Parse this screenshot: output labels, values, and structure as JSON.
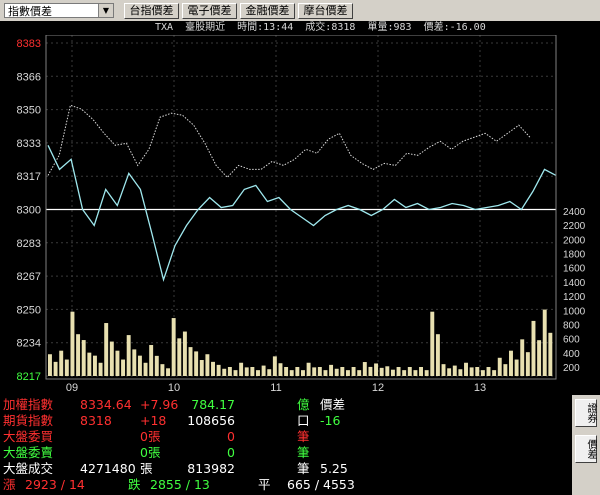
{
  "toolbar": {
    "index_select": "指數價差",
    "buttons": [
      "台指價差",
      "電子價差",
      "金融價差",
      "摩台價差"
    ]
  },
  "info_line": "TXA  臺股期近  時間:13:44  成交:8318  單量:983  價差:-16.00",
  "colors": {
    "index_line": "#dcdcdc",
    "futures_line": "#9fe8ee",
    "volume_bar": "#e8e0b0",
    "up": "#ff3030",
    "down": "#40ff40",
    "axis_red_label": "#ff3030",
    "axis_green_label": "#40ff40"
  },
  "chart_data": {
    "type": "line",
    "price_ticks": [
      "8383",
      "8366",
      "8350",
      "8333",
      "8317",
      "8300",
      "8283",
      "8267",
      "8250",
      "8234",
      "8217"
    ],
    "volume_ticks": [
      "2400",
      "2200",
      "2000",
      "1800",
      "1600",
      "1400",
      "1200",
      "1000",
      "800",
      "600",
      "400",
      "200"
    ],
    "time_ticks": [
      "09",
      "10",
      "11",
      "12",
      "13"
    ],
    "ylim": [
      8217,
      8383
    ],
    "reference": 8300,
    "series": [
      {
        "values": [
          8317,
          8327,
          8352,
          8350,
          8345,
          8338,
          8332,
          8333,
          8322,
          8330,
          8346,
          8348,
          8347,
          8342,
          8333,
          8322,
          8316,
          8322,
          8320,
          8320,
          8324,
          8322,
          8325,
          8330,
          8328,
          8335,
          8338,
          8327,
          8323,
          8320,
          8323,
          8322,
          8328,
          8327,
          8331,
          8334,
          8330,
          8334,
          8336,
          8338,
          8334,
          8338,
          8342,
          8336
        ]
      },
      {
        "values": [
          8332,
          8320,
          8325,
          8300,
          8292,
          8310,
          8302,
          8318,
          8310,
          8288,
          8265,
          8282,
          8292,
          8300,
          8306,
          8301,
          8302,
          8310,
          8312,
          8304,
          8306,
          8300,
          8296,
          8292,
          8297,
          8300,
          8302,
          8300,
          8297,
          8300,
          8305,
          8301,
          8303,
          8300,
          8301,
          8303,
          8302,
          8300,
          8301,
          8302,
          8304,
          8300,
          8309,
          8320,
          8317
        ]
      }
    ],
    "volume": [
      380,
      430,
      980,
      580,
      360,
      820,
      430,
      650,
      360,
      510,
      240,
      890,
      700,
      420,
      380,
      230,
      190,
      260,
      200,
      220,
      350,
      180,
      160,
      260,
      200,
      230,
      190,
      180,
      270,
      250,
      210,
      200,
      190,
      180,
      980,
      240,
      220,
      260,
      200,
      190,
      330,
      430,
      590,
      850,
      1010
    ]
  },
  "table": {
    "rows": [
      [
        {
          "text": "加權指數",
          "color": "#ff3030"
        },
        {
          "text": "8334.64",
          "color": "#ff3030"
        },
        {
          "text": "+7.96",
          "color": "#ff3030"
        },
        {
          "text": "784.17",
          "color": "#40ff40"
        },
        {
          "text": "億",
          "color": "#40ff40"
        },
        {
          "text": "價差",
          "color": "#ffffff"
        }
      ],
      [
        {
          "text": "期貨指數",
          "color": "#ff3030"
        },
        {
          "text": "8318",
          "color": "#ff3030"
        },
        {
          "text": "+18",
          "color": "#ff3030"
        },
        {
          "text": "108656",
          "color": "#ffffff"
        },
        {
          "text": "口",
          "color": "#ffffff"
        },
        {
          "text": "-16",
          "color": "#40ff40"
        }
      ],
      [
        {
          "text": "大盤委買",
          "color": "#ff3030"
        },
        {
          "text": "",
          "color": "#ff3030"
        },
        {
          "text": "0張",
          "color": "#ff3030"
        },
        {
          "text": "0",
          "color": "#ff3030"
        },
        {
          "text": "筆",
          "color": "#ff3030"
        },
        {
          "text": "",
          "color": "#ffffff"
        }
      ],
      [
        {
          "text": "大盤委賣",
          "color": "#40ff40"
        },
        {
          "text": "",
          "color": "#40ff40"
        },
        {
          "text": "0張",
          "color": "#40ff40"
        },
        {
          "text": "0",
          "color": "#40ff40"
        },
        {
          "text": "筆",
          "color": "#40ff40"
        },
        {
          "text": "",
          "color": "#ffffff"
        }
      ],
      [
        {
          "text": "大盤成交",
          "color": "#ffffff"
        },
        {
          "text": "4271480",
          "color": "#ffffff"
        },
        {
          "text": "張",
          "color": "#ffffff"
        },
        {
          "text": "813982",
          "color": "#ffffff"
        },
        {
          "text": "筆",
          "color": "#ffffff"
        },
        {
          "text": "5.25",
          "color": "#ffffff"
        }
      ]
    ],
    "breadth": {
      "up_label": "漲",
      "up_value": "2923 / 14",
      "down_label": "跌",
      "down_value": "2855 / 13",
      "flat_label": "平",
      "flat_value": "665 / 4553"
    }
  },
  "side_buttons": [
    "證券",
    "價差"
  ]
}
